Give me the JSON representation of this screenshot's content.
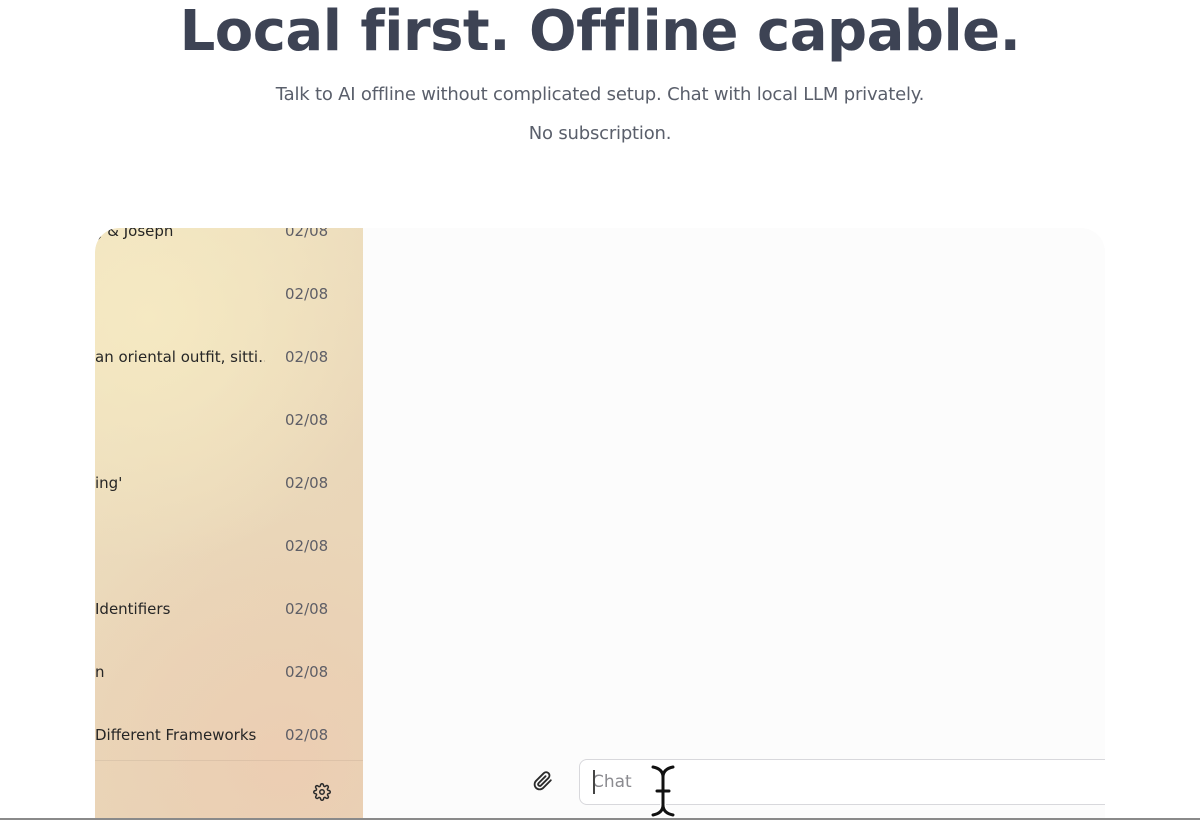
{
  "hero": {
    "title": "Local first. Offline capable.",
    "subtitle_line1": "Talk to AI offline without complicated setup. Chat with local LLM privately.",
    "subtitle_line2": "No subscription."
  },
  "sidebar": {
    "chats": [
      {
        "title": "ˏ & Joseph",
        "date": "02/08"
      },
      {
        "title": "",
        "date": "02/08"
      },
      {
        "title": "an oriental outfit, sitti…",
        "date": "02/08"
      },
      {
        "title": "",
        "date": "02/08"
      },
      {
        "title": "ing'",
        "date": "02/08"
      },
      {
        "title": "",
        "date": "02/08"
      },
      {
        "title": "Identifiers",
        "date": "02/08"
      },
      {
        "title": "n",
        "date": "02/08"
      },
      {
        "title": "Different Frameworks",
        "date": "02/08"
      }
    ],
    "settings_icon": "gear-icon"
  },
  "composer": {
    "attach_icon": "paperclip-icon",
    "placeholder": "Chat"
  },
  "colors": {
    "title": "#3d4354",
    "sidebar_bg": "#ead7b9",
    "text": "#262626"
  }
}
